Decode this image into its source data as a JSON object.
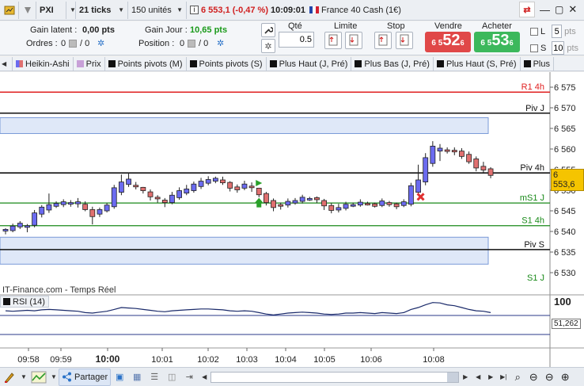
{
  "toolbar": {
    "symbol": "PXI",
    "ticks": "21 ticks",
    "units": "150 unités",
    "price_change": "6 553,1 (-0,47 %)",
    "time": "10:09:01",
    "instrument": "France 40 Cash (1€)"
  },
  "info": {
    "gain_latent_label": "Gain latent :",
    "gain_latent_value": "0,00 pts",
    "gain_jour_label": "Gain Jour :",
    "gain_jour_value": "10,65 pts",
    "ordres_label": "Ordres :",
    "ordres_a": "0",
    "ordres_b": "/ 0",
    "position_label": "Position :",
    "position_a": "0",
    "position_b": "/ 0"
  },
  "order": {
    "qty_label": "Qté",
    "qty_value": "0.5",
    "limit_label": "Limite",
    "stop_label": "Stop",
    "sell_label": "Vendre",
    "buy_label": "Acheter",
    "sell_prefix": "6 5",
    "sell_big": "52",
    "sell_sup": "6",
    "buy_prefix": "6 5",
    "buy_big": "53",
    "buy_sup": "6",
    "l_label": "L",
    "l_value": "5",
    "l_unit": "pts",
    "s_label": "S",
    "s_value": "10",
    "s_unit": "pts"
  },
  "indicators": [
    "Heikin-Ashi",
    "Prix",
    "Points pivots (M)",
    "Points pivots (S)",
    "Plus Haut (J, Pré)",
    "Plus Bas (J, Pré)",
    "Plus Haut (S, Pré)",
    "Plus"
  ],
  "chart": {
    "source": "IT-Finance.com - Temps Réel",
    "rsi_label": "RSI (14)",
    "rsi_top": "100",
    "rsi_value": "51,262",
    "current_price": "6 553,6",
    "y_ticks": [
      "6 575",
      "6 570",
      "6 565",
      "6 560",
      "6 555",
      "6 550",
      "6 545",
      "6 540",
      "6 535",
      "6 530"
    ],
    "x_ticks": [
      "09:58",
      "09:59",
      "10:00",
      "10:01",
      "10:02",
      "10:03",
      "10:04",
      "10:05",
      "10:06",
      "10:08"
    ],
    "levels": [
      {
        "label": "R1 4h",
        "price": 6573.8,
        "color": "#e02020"
      },
      {
        "label": "Piv J",
        "price": 6568.7,
        "color": "#111111"
      },
      {
        "label": "Piv 4h",
        "price": 6554.2,
        "color": "#111111"
      },
      {
        "label": "mS1 J",
        "price": 6546.9,
        "color": "#1a8a1a"
      },
      {
        "label": "S1 4h",
        "price": 6541.4,
        "color": "#1a8a1a"
      },
      {
        "label": "Piv S",
        "price": 6535.6,
        "color": "#111111"
      },
      {
        "label": "S1 J",
        "price": 6527.5,
        "color": "#1a8a1a"
      }
    ]
  },
  "bottom": {
    "partager": "Partager"
  },
  "colors": {
    "bull": "#6b6bf0",
    "bear": "#e07070",
    "sell": "#e04848",
    "buy": "#3cb85c"
  }
}
